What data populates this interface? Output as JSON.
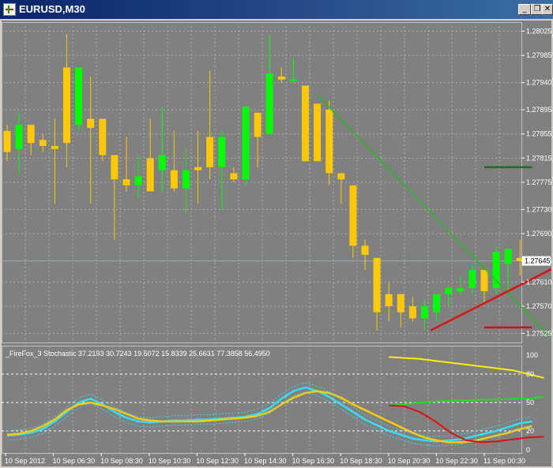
{
  "window": {
    "title": "EURUSD,M30",
    "buttons": [
      "minimize-icon",
      "restore-icon",
      "close-icon"
    ]
  },
  "colors": {
    "background": "#808080",
    "grid": "#a8a8a8",
    "bull": "#00ff00",
    "bear": "#ffc800",
    "trend_green": "#22bb22",
    "support_red": "#dd1111",
    "stoch_main": "#ffcc00",
    "stoch_signal": "#33ddff"
  },
  "price_axis": [
    "1.28025",
    "1.27985",
    "1.27940",
    "1.27895",
    "1.27855",
    "1.27815",
    "1.27775",
    "1.27730",
    "1.27690",
    "1.27645",
    "1.27610",
    "1.27570",
    "1.27525"
  ],
  "current_price": "1.27645",
  "indicator": {
    "title": "_FireFox_3 Stochastic 37.2193 30.7243 19.5072 15.8339 25.6631 77.3858 56.4950",
    "levels": [
      "100",
      "80",
      "50",
      "20",
      "0"
    ]
  },
  "time_axis": [
    "10 Sep 2012",
    "10 Sep 06:30",
    "10 Sep 08:30",
    "10 Sep 10:30",
    "10 Sep 12:30",
    "10 Sep 14:30",
    "10 Sep 16:30",
    "10 Sep 18:30",
    "10 Sep 20:30",
    "10 Sep 22:30",
    "11 Sep 00:30"
  ],
  "chart_data": {
    "type": "candlestick",
    "symbol": "EURUSD",
    "timeframe": "M30",
    "ylim": [
      1.2751,
      1.2804
    ],
    "candles": [
      {
        "o": 1.2786,
        "h": 1.2787,
        "l": 1.2781,
        "c": 1.27825
      },
      {
        "o": 1.2783,
        "h": 1.2789,
        "l": 1.2779,
        "c": 1.2787
      },
      {
        "o": 1.2787,
        "h": 1.2787,
        "l": 1.2782,
        "c": 1.2784
      },
      {
        "o": 1.27845,
        "h": 1.27855,
        "l": 1.27825,
        "c": 1.27835
      },
      {
        "o": 1.27835,
        "h": 1.2788,
        "l": 1.2774,
        "c": 1.2783
      },
      {
        "o": 1.27965,
        "h": 1.2802,
        "l": 1.278,
        "c": 1.2784
      },
      {
        "o": 1.2787,
        "h": 1.27965,
        "l": 1.2786,
        "c": 1.27965
      },
      {
        "o": 1.2788,
        "h": 1.2795,
        "l": 1.2774,
        "c": 1.27865
      },
      {
        "o": 1.2788,
        "h": 1.2788,
        "l": 1.2781,
        "c": 1.2782
      },
      {
        "o": 1.2782,
        "h": 1.2782,
        "l": 1.2768,
        "c": 1.2778
      },
      {
        "o": 1.2778,
        "h": 1.2785,
        "l": 1.2776,
        "c": 1.2777
      },
      {
        "o": 1.2777,
        "h": 1.2782,
        "l": 1.2775,
        "c": 1.27785
      },
      {
        "o": 1.27815,
        "h": 1.2788,
        "l": 1.2776,
        "c": 1.2776
      },
      {
        "o": 1.27795,
        "h": 1.279,
        "l": 1.2776,
        "c": 1.2782
      },
      {
        "o": 1.27795,
        "h": 1.2786,
        "l": 1.2776,
        "c": 1.27765
      },
      {
        "o": 1.27765,
        "h": 1.2783,
        "l": 1.27725,
        "c": 1.27795
      },
      {
        "o": 1.278,
        "h": 1.2786,
        "l": 1.2774,
        "c": 1.27795
      },
      {
        "o": 1.2785,
        "h": 1.2796,
        "l": 1.2778,
        "c": 1.278
      },
      {
        "o": 1.278,
        "h": 1.2786,
        "l": 1.2773,
        "c": 1.2785
      },
      {
        "o": 1.2779,
        "h": 1.278,
        "l": 1.27775,
        "c": 1.2778
      },
      {
        "o": 1.2778,
        "h": 1.2788,
        "l": 1.2777,
        "c": 1.279
      },
      {
        "o": 1.2789,
        "h": 1.2789,
        "l": 1.278,
        "c": 1.2785
      },
      {
        "o": 1.27855,
        "h": 1.2802,
        "l": 1.27855,
        "c": 1.27955
      },
      {
        "o": 1.2795,
        "h": 1.27965,
        "l": 1.2794,
        "c": 1.27945
      },
      {
        "o": 1.27945,
        "h": 1.2798,
        "l": 1.2794,
        "c": 1.27945
      },
      {
        "o": 1.27935,
        "h": 1.27935,
        "l": 1.2781,
        "c": 1.2781
      },
      {
        "o": 1.27905,
        "h": 1.27905,
        "l": 1.2781,
        "c": 1.2781
      },
      {
        "o": 1.27895,
        "h": 1.2791,
        "l": 1.2777,
        "c": 1.2779
      },
      {
        "o": 1.2779,
        "h": 1.2779,
        "l": 1.2774,
        "c": 1.2778
      },
      {
        "o": 1.2777,
        "h": 1.2777,
        "l": 1.2765,
        "c": 1.2767
      },
      {
        "o": 1.2767,
        "h": 1.2768,
        "l": 1.2763,
        "c": 1.27655
      },
      {
        "o": 1.2765,
        "h": 1.2765,
        "l": 1.2753,
        "c": 1.2756
      },
      {
        "o": 1.2759,
        "h": 1.2761,
        "l": 1.27545,
        "c": 1.2757
      },
      {
        "o": 1.2759,
        "h": 1.2759,
        "l": 1.27535,
        "c": 1.2756
      },
      {
        "o": 1.2757,
        "h": 1.27585,
        "l": 1.27545,
        "c": 1.2755
      },
      {
        "o": 1.2755,
        "h": 1.2758,
        "l": 1.2753,
        "c": 1.2757
      },
      {
        "o": 1.2756,
        "h": 1.2759,
        "l": 1.27545,
        "c": 1.2759
      },
      {
        "o": 1.2759,
        "h": 1.27605,
        "l": 1.2757,
        "c": 1.276
      },
      {
        "o": 1.27595,
        "h": 1.2762,
        "l": 1.2759,
        "c": 1.276
      },
      {
        "o": 1.276,
        "h": 1.2764,
        "l": 1.2759,
        "c": 1.2763
      },
      {
        "o": 1.2763,
        "h": 1.2763,
        "l": 1.27575,
        "c": 1.27595
      },
      {
        "o": 1.276,
        "h": 1.2767,
        "l": 1.2759,
        "c": 1.2766
      },
      {
        "o": 1.2764,
        "h": 1.2766,
        "l": 1.2759,
        "c": 1.27665
      },
      {
        "o": 1.2765,
        "h": 1.2768,
        "l": 1.2762,
        "c": 1.27645
      }
    ],
    "lines": [
      {
        "name": "trendline",
        "color": "#22bb22",
        "from": [
          26,
          1.2792
        ],
        "to": [
          45.5,
          1.2752
        ]
      },
      {
        "name": "support",
        "color": "#dd1111",
        "from": [
          35.5,
          1.2753
        ],
        "to": [
          46,
          1.27635
        ]
      },
      {
        "name": "resistance",
        "color": "#117711",
        "from": [
          40,
          1.278
        ],
        "to": [
          44,
          1.278
        ]
      },
      {
        "name": "target",
        "color": "#cc1111",
        "from": [
          40,
          1.27535
        ],
        "to": [
          44,
          1.27535
        ]
      }
    ],
    "stochastic": {
      "main": [
        16,
        17,
        20,
        25,
        32,
        42,
        48,
        50,
        47,
        43,
        38,
        33,
        31,
        30,
        30,
        30,
        30,
        31,
        32,
        33,
        34,
        36,
        40,
        48,
        55,
        60,
        62,
        60,
        55,
        48,
        42,
        36,
        30,
        24,
        18,
        13,
        10,
        8,
        8,
        9,
        12,
        15,
        18,
        22,
        25
      ],
      "signal": [
        15,
        16,
        18,
        22,
        30,
        40,
        50,
        54,
        48,
        40,
        34,
        30,
        29,
        30,
        31,
        31,
        32,
        32,
        33,
        34,
        35,
        38,
        44,
        54,
        62,
        66,
        62,
        56,
        48,
        40,
        32,
        26,
        20,
        16,
        12,
        10,
        9,
        10,
        11,
        14,
        17,
        20,
        24,
        28,
        30
      ]
    }
  }
}
